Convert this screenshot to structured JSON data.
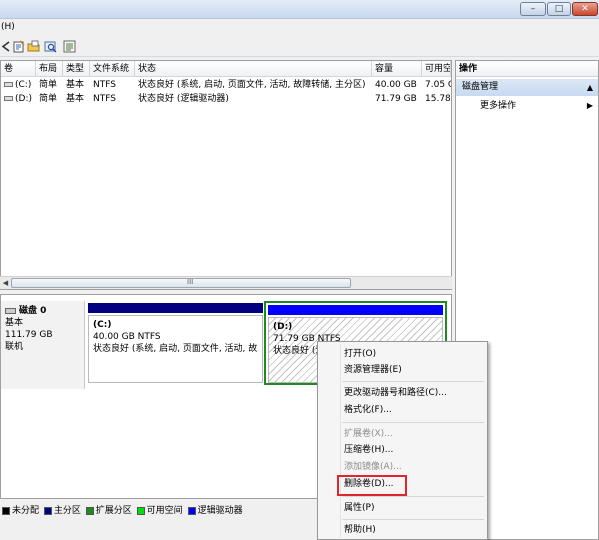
{
  "menubar": {
    "help": "(H)"
  },
  "toolbar": {
    "icons": [
      "back-arrow-icon",
      "properties-icon",
      "open-folder-icon",
      "help-icon",
      "refresh-icon"
    ]
  },
  "volume_list": {
    "columns": [
      "卷",
      "布局",
      "类型",
      "文件系统",
      "状态",
      "容量",
      "可用空"
    ],
    "rows": [
      {
        "name": "(C:)",
        "layout": "简单",
        "type": "基本",
        "fs": "NTFS",
        "status": "状态良好 (系统, 启动, 页面文件, 活动, 故障转储, 主分区)",
        "capacity": "40.00 GB",
        "free": "7.05 G"
      },
      {
        "name": "(D:)",
        "layout": "简单",
        "type": "基本",
        "fs": "NTFS",
        "status": "状态良好 (逻辑驱动器)",
        "capacity": "71.79 GB",
        "free": "15.78"
      }
    ],
    "scrollbar_grip": "III"
  },
  "actions": {
    "title": "操作",
    "section": "磁盘管理",
    "more": "更多操作"
  },
  "disk": {
    "label": "磁盘 0",
    "type": "基本",
    "size": "111.79 GB",
    "status": "联机",
    "partitions": [
      {
        "name": "(C:)",
        "size": "40.00 GB NTFS",
        "status": "状态良好 (系统, 启动, 页面文件, 活动, 故"
      },
      {
        "name": "(D:)",
        "size": "71.79 GB NTFS",
        "status": "状态良好 (逻"
      }
    ]
  },
  "legend": [
    {
      "label": "未分配",
      "color": "#000000"
    },
    {
      "label": "主分区",
      "color": "#000080"
    },
    {
      "label": "扩展分区",
      "color": "#1f8a1f"
    },
    {
      "label": "可用空间",
      "color": "#00e000"
    },
    {
      "label": "逻辑驱动器",
      "color": "#0000ff"
    }
  ],
  "context_menu": {
    "open": "打开(O)",
    "explore": "资源管理器(E)",
    "change_letter": "更改驱动器号和路径(C)...",
    "format": "格式化(F)...",
    "extend": "扩展卷(X)...",
    "shrink": "压缩卷(H)...",
    "add_mirror": "添加镜像(A)...",
    "delete": "删除卷(D)...",
    "properties": "属性(P)",
    "help": "帮助(H)"
  },
  "highlight_color": "#e0262a"
}
